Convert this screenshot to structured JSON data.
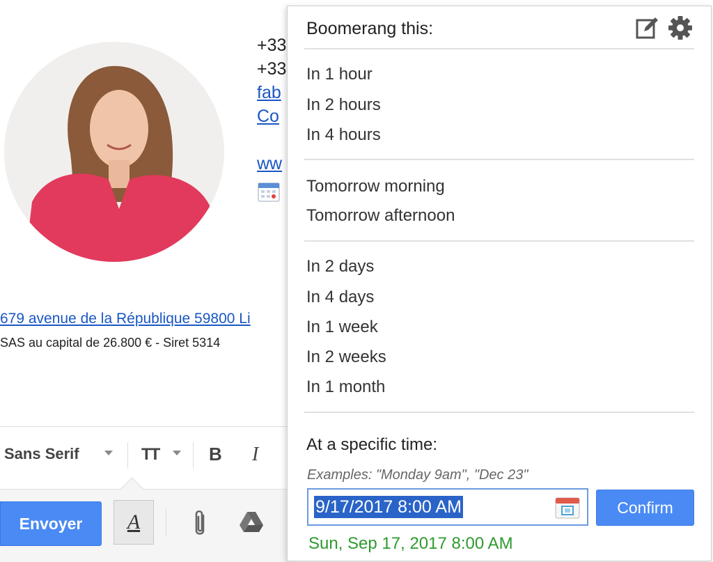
{
  "compose": {
    "contact_lines": [
      "+33",
      "+33",
      "fab",
      "Co",
      "ww"
    ],
    "address_link": "679 avenue de la République 59800 Li",
    "legal_text": "SAS au capital de 26.800 € - Siret 5314",
    "toolbar": {
      "font_label": "Sans Serif",
      "size_icon": "TT",
      "bold_label": "B",
      "italic_label": "I"
    },
    "send_label": "Envoyer",
    "format_label": "A"
  },
  "popup": {
    "title": "Boomerang this:",
    "groups": [
      [
        "In 1 hour",
        "In 2 hours",
        "In 4 hours"
      ],
      [
        "Tomorrow morning",
        "Tomorrow afternoon"
      ],
      [
        "In 2 days",
        "In 4 days",
        "In 1 week",
        "In 2 weeks",
        "In 1 month"
      ]
    ],
    "specific_label": "At a specific time:",
    "examples": "Examples: \"Monday 9am\", \"Dec 23\"",
    "datetime_value": "9/17/2017 8:00 AM",
    "confirm_label": "Confirm",
    "parsed_date": "Sun, Sep 17, 2017 8:00 AM"
  },
  "colors": {
    "accent_blue": "#4a8af4",
    "link_blue": "#1a56c4",
    "parsed_green": "#2e9a2e",
    "selection_blue": "#2a64c8"
  },
  "icons": [
    "edit-icon",
    "gear-icon",
    "calendar-icon",
    "paperclip-icon",
    "drive-icon"
  ]
}
